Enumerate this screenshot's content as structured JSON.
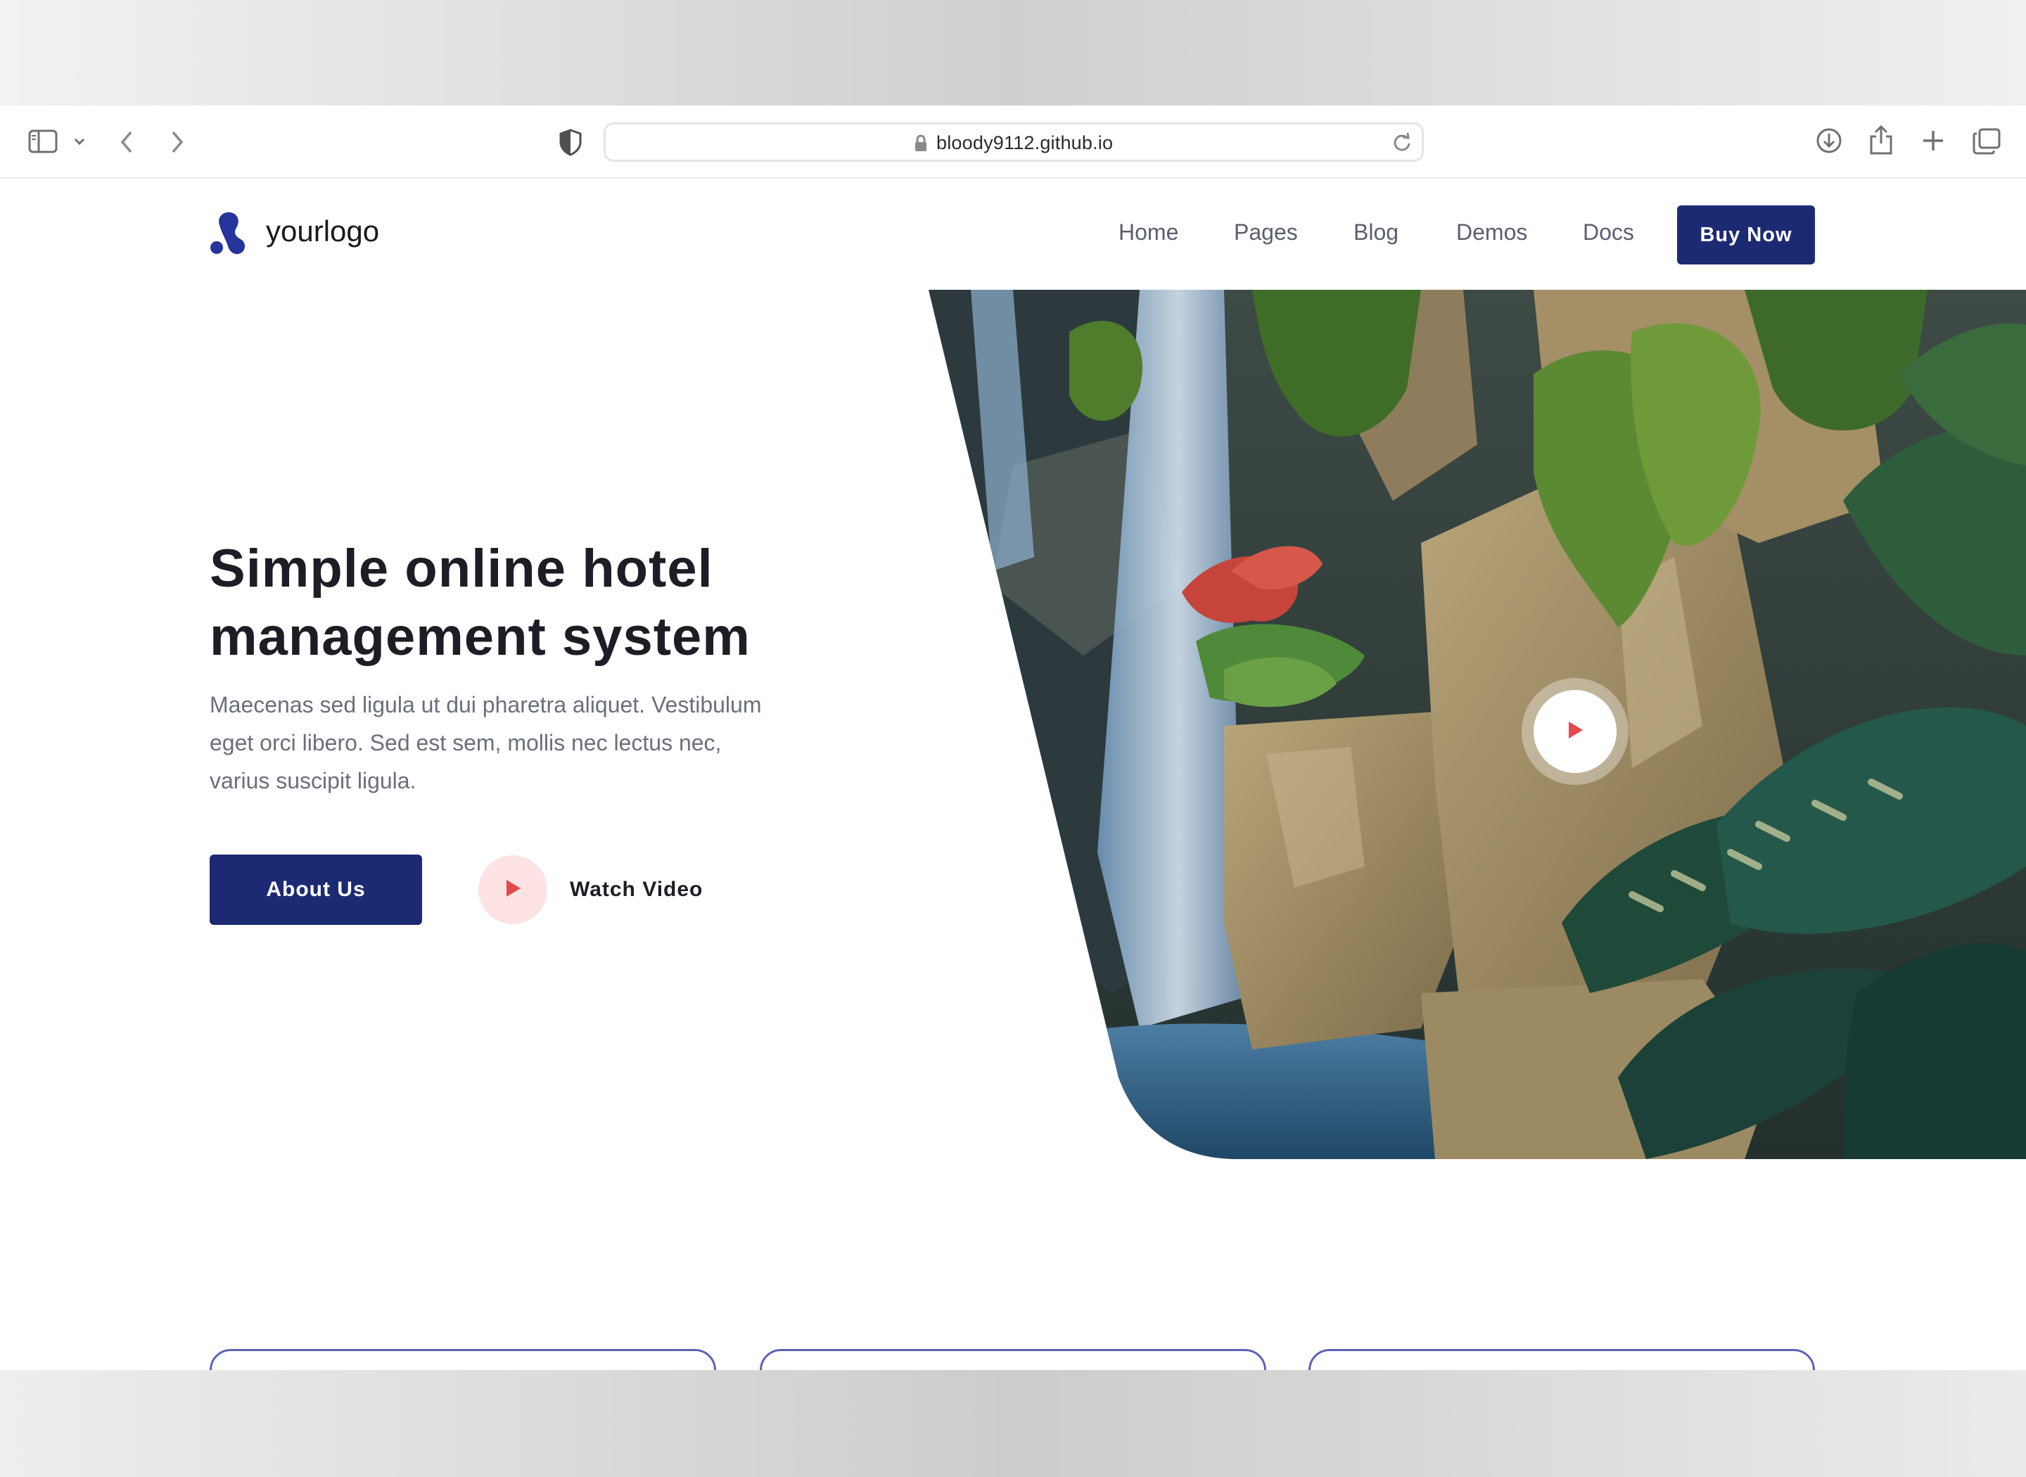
{
  "browser": {
    "url": "bloody9112.github.io",
    "icons": [
      "sidebar-icon",
      "chevron-down-icon",
      "back-icon",
      "forward-icon",
      "shield-icon",
      "lock-icon",
      "reload-icon",
      "download-icon",
      "share-icon",
      "new-tab-icon",
      "tabs-overview-icon"
    ]
  },
  "site": {
    "logo_text": "yourlogo",
    "nav": {
      "home": "Home",
      "pages": "Pages",
      "blog": "Blog",
      "demos": "Demos",
      "docs": "Docs"
    },
    "buy_now": "Buy Now"
  },
  "hero": {
    "title_line1": "Simple online hotel",
    "title_line2": "management system",
    "desc_line1": "Maecenas sed ligula ut dui pharetra aliquet. Vestibulum",
    "desc_line2": "eget orci libero. Sed est sem, mollis nec lectus nec,",
    "desc_line3": "varius suscipit ligula.",
    "about_button": "About Us",
    "watch_video": "Watch Video"
  },
  "colors": {
    "brand_navy": "#1c2a73",
    "play_accent": "#e5484d",
    "play_bg": "#fde3e3",
    "card_border": "#5b63b3"
  }
}
